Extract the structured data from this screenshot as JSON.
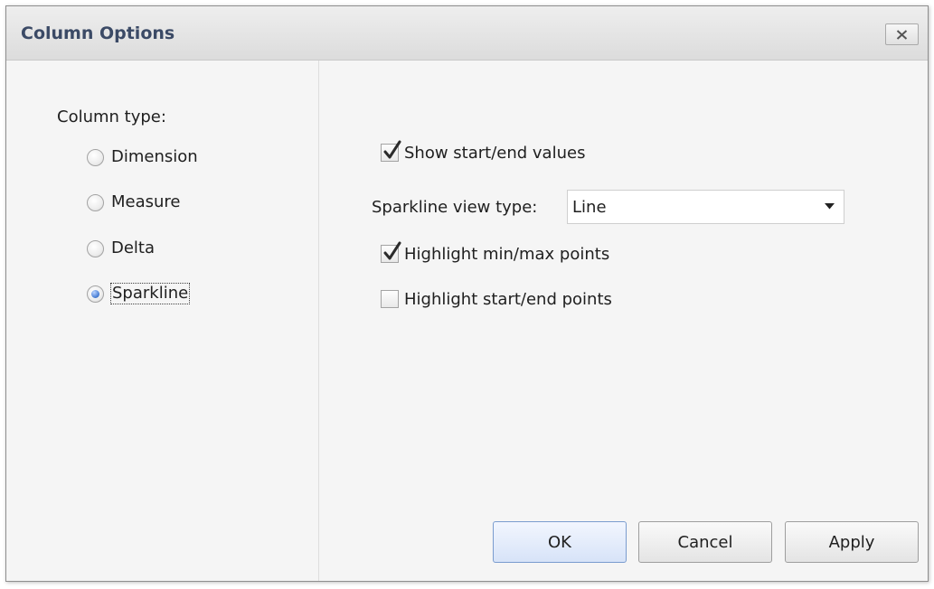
{
  "dialog": {
    "title": "Column Options",
    "close_label": "close"
  },
  "column_type": {
    "label": "Column type:",
    "options": [
      {
        "label": "Dimension",
        "selected": false
      },
      {
        "label": "Measure",
        "selected": false
      },
      {
        "label": "Delta",
        "selected": false
      },
      {
        "label": "Sparkline",
        "selected": true
      }
    ]
  },
  "sparkline": {
    "show_start_end_values": {
      "label": "Show start/end values",
      "checked": true
    },
    "view_type": {
      "label": "Sparkline view type:",
      "value": "Line"
    },
    "highlight_min_max": {
      "label": "Highlight min/max points",
      "checked": true
    },
    "highlight_start_end": {
      "label": "Highlight start/end points",
      "checked": false
    }
  },
  "buttons": {
    "ok": "OK",
    "cancel": "Cancel",
    "apply": "Apply"
  },
  "colors": {
    "title_text": "#3b4a66",
    "default_button": "#d7e3f8",
    "radio_selected": "#4a7fd4"
  },
  "icons": {
    "close": "close-icon",
    "dropdown": "chevron-down-icon",
    "check": "check-icon"
  }
}
